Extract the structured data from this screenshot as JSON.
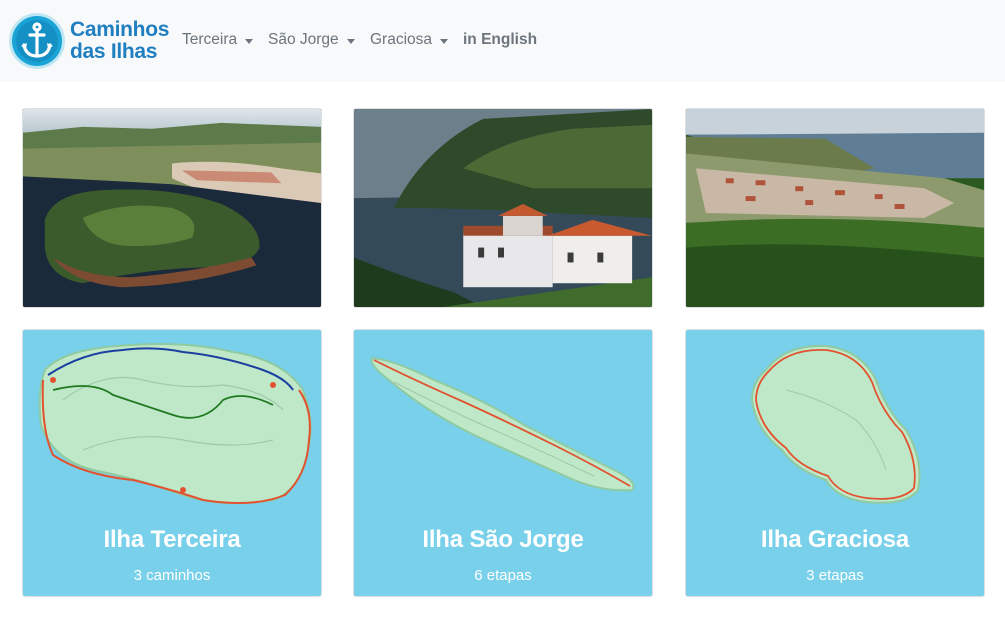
{
  "brand": {
    "line1": "Caminhos",
    "line2": "das Ilhas",
    "color": "#1f7fc1"
  },
  "nav": [
    {
      "label": "Terceira",
      "dropdown": true
    },
    {
      "label": "São Jorge",
      "dropdown": true
    },
    {
      "label": "Graciosa",
      "dropdown": true
    },
    {
      "label": "in English",
      "dropdown": false
    }
  ],
  "photos": [
    {
      "alt": "Terceira"
    },
    {
      "alt": "São Jorge"
    },
    {
      "alt": "Graciosa"
    }
  ],
  "islands": [
    {
      "title": "Ilha Terceira",
      "subtitle": "3 caminhos"
    },
    {
      "title": "Ilha São Jorge",
      "subtitle": "6 etapas"
    },
    {
      "title": "Ilha Graciosa",
      "subtitle": "3 etapas"
    }
  ],
  "colors": {
    "map_background": "#79d0ea",
    "navbar": "#f8f9fa",
    "route": "#e2522f"
  }
}
